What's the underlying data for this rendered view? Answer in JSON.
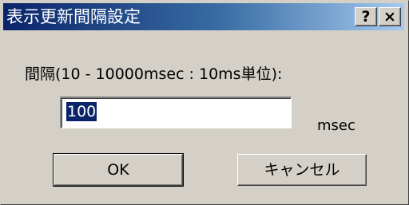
{
  "dialog": {
    "title": "表示更新間隔設定",
    "help_label": "?",
    "close_label": "×",
    "interval_label": "間隔(10 - 10000msec : 10ms単位):",
    "interval_value": "100",
    "unit_label": "msec",
    "ok_label": "OK",
    "cancel_label": "キャンセル"
  }
}
